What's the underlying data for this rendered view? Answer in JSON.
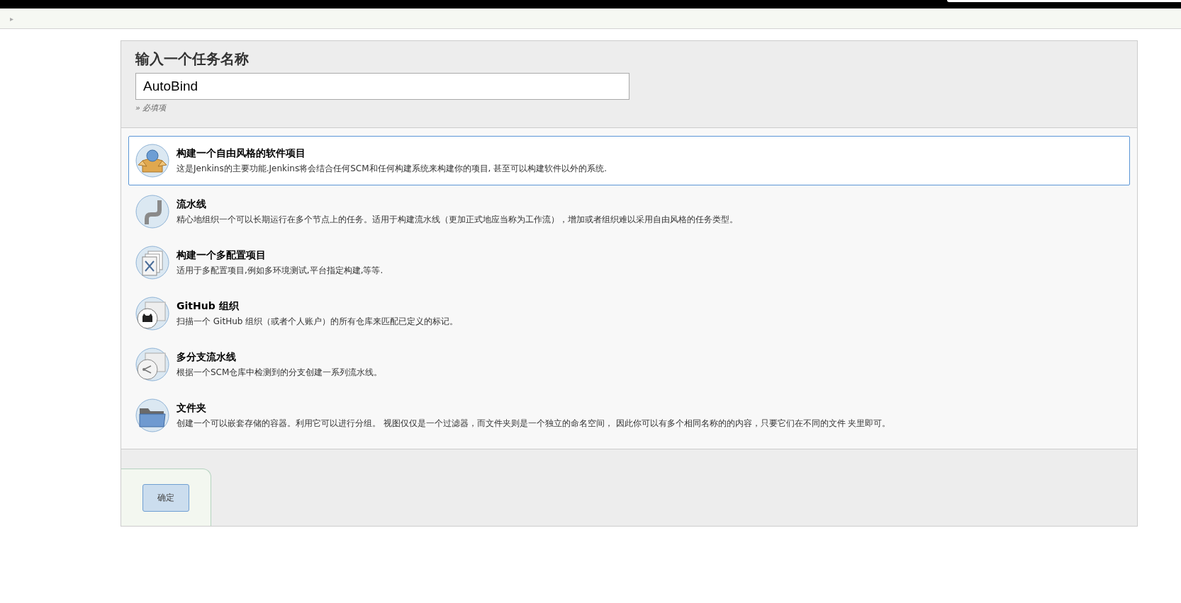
{
  "breadcrumb": {
    "arrow": "▸"
  },
  "form": {
    "title": "输入一个任务名称",
    "name_field": {
      "value": "AutoBind"
    },
    "hint": "» 必填项"
  },
  "items": [
    {
      "kind": "freestyle",
      "title": "构建一个自由风格的软件项目",
      "description": "这是Jenkins的主要功能.Jenkins将会结合任何SCM和任何构建系统来构建你的项目, 甚至可以构建软件以外的系统.",
      "selected": true
    },
    {
      "kind": "pipeline",
      "title": "流水线",
      "description": "精心地组织一个可以长期运行在多个节点上的任务。适用于构建流水线（更加正式地应当称为工作流），增加或者组织难以采用自由风格的任务类型。",
      "selected": false
    },
    {
      "kind": "matrix",
      "title": "构建一个多配置项目",
      "description": "适用于多配置项目,例如多环境测试,平台指定构建,等等.",
      "selected": false
    },
    {
      "kind": "github",
      "title": "GitHub 组织",
      "description": "扫描一个 GitHub 组织（或者个人账户）的所有仓库来匹配已定义的标记。",
      "selected": false
    },
    {
      "kind": "multibranch",
      "title": "多分支流水线",
      "description": "根据一个SCM仓库中检测到的分支创建一系列流水线。",
      "selected": false
    },
    {
      "kind": "folder",
      "title": "文件夹",
      "description": "创建一个可以嵌套存储的容器。利用它可以进行分组。 视图仅仅是一个过滤器，而文件夹则是一个独立的命名空间， 因此你可以有多个相同名称的的内容，只要它们在不同的文件 夹里即可。",
      "selected": false
    }
  ],
  "ok_button": {
    "label": "确定"
  }
}
